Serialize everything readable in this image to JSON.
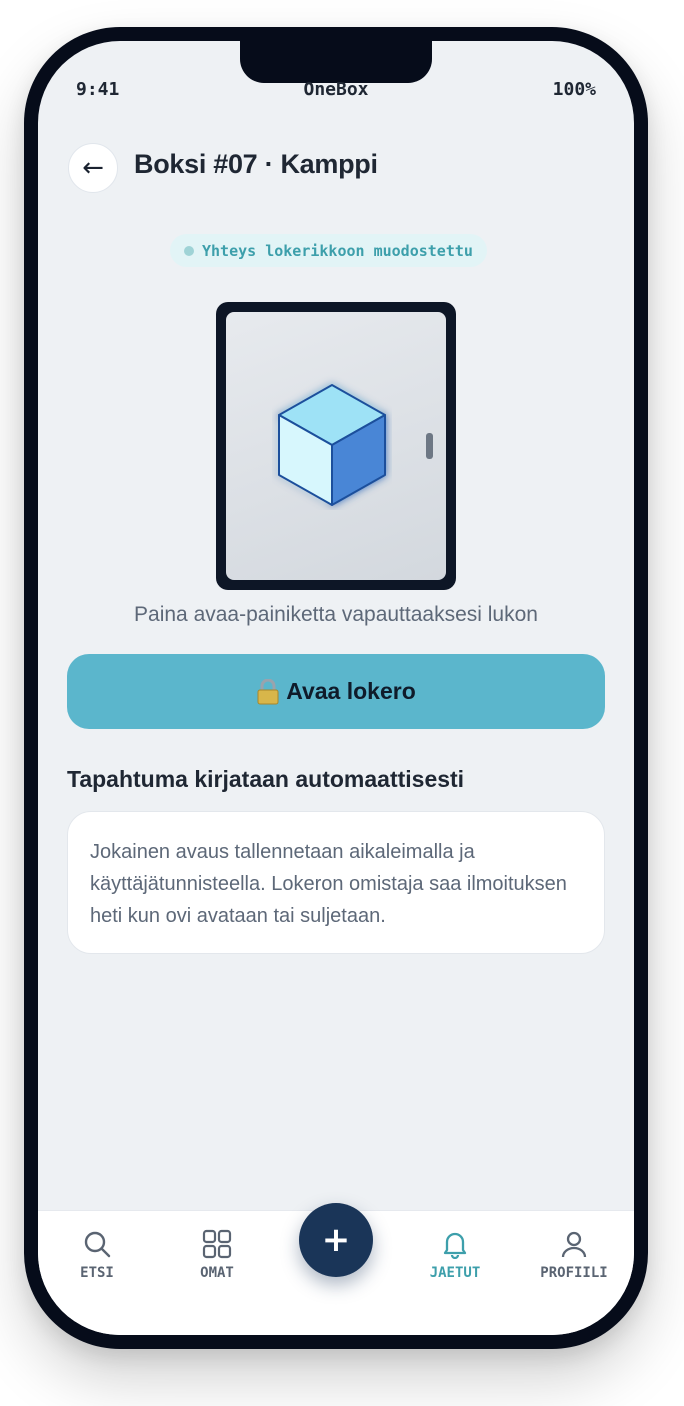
{
  "status_bar": {
    "time": "9:41",
    "carrier": "OneBox",
    "battery": "100%"
  },
  "header": {
    "back_icon": "arrow-left-icon",
    "title": "Boksi #07 · Kamppi"
  },
  "connection": {
    "status_text": "Yhteys lokerikkoon muodostettu",
    "dot_color": "#9fd3d6"
  },
  "locker": {
    "icon": "cube-icon"
  },
  "hint": "Paina avaa-painiketta vapauttaaksesi lukon",
  "open_button": {
    "icon": "padlock-icon",
    "label": "Avaa lokero",
    "color": "#5bb6cc"
  },
  "log_section": {
    "title": "Tapahtuma kirjataan automaattisesti",
    "body": "Jokainen avaus tallennetaan aikaleimalla ja käyttäjätunnisteella. Lokeron omistaja saa ilmoituksen heti kun ovi avataan tai suljetaan."
  },
  "tab_bar": {
    "tabs": [
      {
        "label": "ETSI",
        "icon": "search-icon",
        "active": false
      },
      {
        "label": "OMAT",
        "icon": "grid-icon",
        "active": false
      },
      {
        "label": "JAETUT",
        "icon": "bell-icon",
        "active": true
      },
      {
        "label": "PROFIILI",
        "icon": "user-icon",
        "active": false
      }
    ],
    "fab_label": "+",
    "accent": "#3d9fab"
  }
}
